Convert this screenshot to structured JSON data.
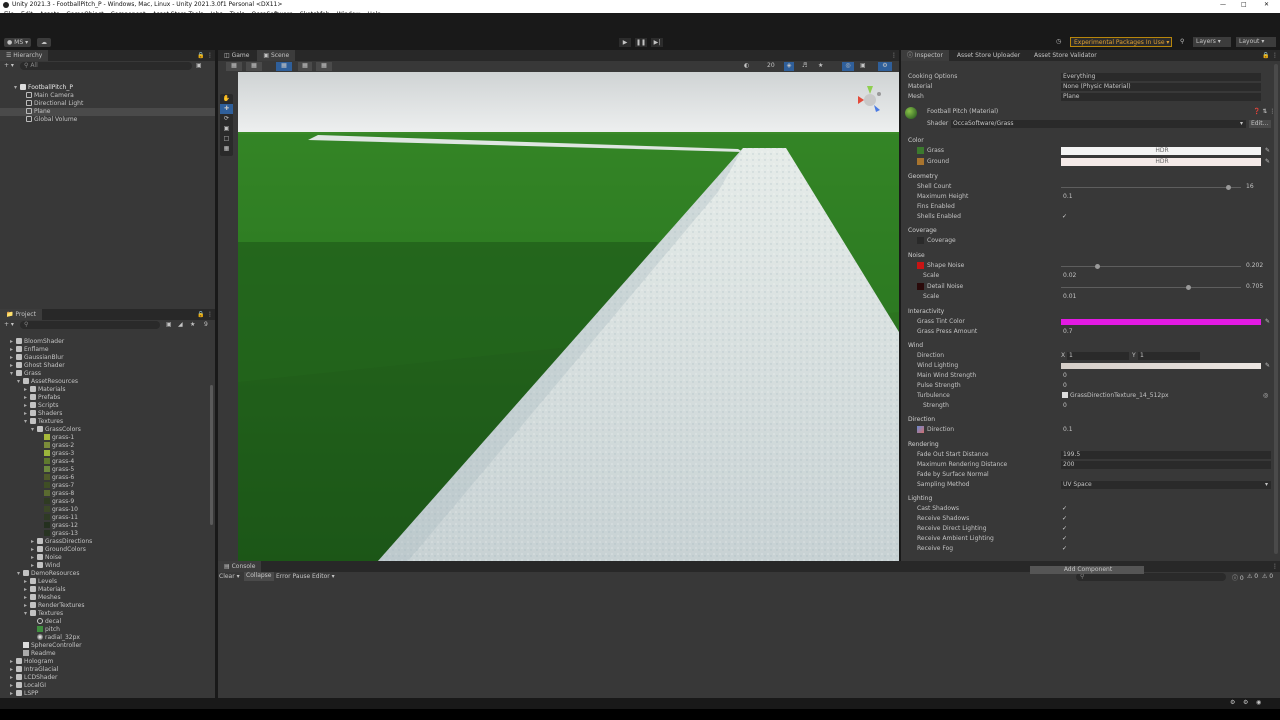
{
  "window": {
    "title": "Unity 2021.3 - FootballPitch_P - Windows, Mac, Linux - Unity 2021.3.0f1 Personal <DX11>"
  },
  "menu": [
    "File",
    "Edit",
    "Assets",
    "GameObject",
    "Component",
    "Asset Store Tools",
    "Jobs",
    "Tools",
    "OccaSoftware",
    "Sketchfab",
    "Window",
    "Help"
  ],
  "toolbar": {
    "account": "MS",
    "experimental": "Experimental Packages In Use",
    "layers": "Layers",
    "layout": "Layout"
  },
  "hierarchy": {
    "tab": "Hierarchy",
    "search": "All",
    "scene": "FootballPitch_P",
    "items": [
      "Main Camera",
      "Directional Light",
      "Plane",
      "Global Volume"
    ]
  },
  "project": {
    "tab": "Project",
    "count": "9",
    "tree": [
      {
        "label": "BloomShader",
        "indent": 1,
        "kind": "folder"
      },
      {
        "label": "Enflame",
        "indent": 1,
        "kind": "folder"
      },
      {
        "label": "GaussianBlur",
        "indent": 1,
        "kind": "folder"
      },
      {
        "label": "Ghost Shader",
        "indent": 1,
        "kind": "folder"
      },
      {
        "label": "Grass",
        "indent": 1,
        "kind": "folder",
        "open": true
      },
      {
        "label": "AssetResources",
        "indent": 2,
        "kind": "folder",
        "open": true
      },
      {
        "label": "Materials",
        "indent": 3,
        "kind": "folder"
      },
      {
        "label": "Prefabs",
        "indent": 3,
        "kind": "folder"
      },
      {
        "label": "Scripts",
        "indent": 3,
        "kind": "folder"
      },
      {
        "label": "Shaders",
        "indent": 3,
        "kind": "folder"
      },
      {
        "label": "Textures",
        "indent": 3,
        "kind": "folder",
        "open": true
      },
      {
        "label": "GrassColors",
        "indent": 4,
        "kind": "folder",
        "open": true
      },
      {
        "label": "grass-1",
        "indent": 5,
        "kind": "tex",
        "color": "#a6b83a"
      },
      {
        "label": "grass-2",
        "indent": 5,
        "kind": "tex",
        "color": "#7b8c3a"
      },
      {
        "label": "grass-3",
        "indent": 5,
        "kind": "tex",
        "color": "#9bb63c"
      },
      {
        "label": "grass-4",
        "indent": 5,
        "kind": "tex",
        "color": "#5f7a2e"
      },
      {
        "label": "grass-5",
        "indent": 5,
        "kind": "tex",
        "color": "#6d8a3e"
      },
      {
        "label": "grass-6",
        "indent": 5,
        "kind": "tex",
        "color": "#4f5a2a"
      },
      {
        "label": "grass-7",
        "indent": 5,
        "kind": "tex",
        "color": "#3f4e25"
      },
      {
        "label": "grass-8",
        "indent": 5,
        "kind": "tex",
        "color": "#5a6a30"
      },
      {
        "label": "grass-9",
        "indent": 5,
        "kind": "tex",
        "color": "#2f3b22"
      },
      {
        "label": "grass-10",
        "indent": 5,
        "kind": "tex",
        "color": "#3b4727"
      },
      {
        "label": "grass-11",
        "indent": 5,
        "kind": "tex",
        "color": "#2e3a24"
      },
      {
        "label": "grass-12",
        "indent": 5,
        "kind": "tex",
        "color": "#24301f"
      },
      {
        "label": "grass-13",
        "indent": 5,
        "kind": "tex",
        "color": "#283422"
      },
      {
        "label": "GrassDirections",
        "indent": 4,
        "kind": "folder"
      },
      {
        "label": "GroundColors",
        "indent": 4,
        "kind": "folder"
      },
      {
        "label": "Noise",
        "indent": 4,
        "kind": "folder"
      },
      {
        "label": "Wind",
        "indent": 4,
        "kind": "folder"
      },
      {
        "label": "DemoResources",
        "indent": 2,
        "kind": "folder",
        "open": true
      },
      {
        "label": "Levels",
        "indent": 3,
        "kind": "folder"
      },
      {
        "label": "Materials",
        "indent": 3,
        "kind": "folder"
      },
      {
        "label": "Meshes",
        "indent": 3,
        "kind": "folder"
      },
      {
        "label": "RenderTextures",
        "indent": 3,
        "kind": "folder"
      },
      {
        "label": "Textures",
        "indent": 3,
        "kind": "folder",
        "open": true
      },
      {
        "label": "decal",
        "indent": 4,
        "kind": "circle"
      },
      {
        "label": "pitch",
        "indent": 4,
        "kind": "tex",
        "color": "#3f8f3f"
      },
      {
        "label": "radial_32px",
        "indent": 4,
        "kind": "dot"
      },
      {
        "label": "SphereController",
        "indent": 2,
        "kind": "script"
      },
      {
        "label": "Readme",
        "indent": 2,
        "kind": "doc"
      },
      {
        "label": "Hologram",
        "indent": 1,
        "kind": "folder"
      },
      {
        "label": "IntraGlacial",
        "indent": 1,
        "kind": "folder"
      },
      {
        "label": "LCDShader",
        "indent": 1,
        "kind": "folder"
      },
      {
        "label": "LocalGI",
        "indent": 1,
        "kind": "folder"
      },
      {
        "label": "LSPP",
        "indent": 1,
        "kind": "folder"
      }
    ]
  },
  "view": {
    "tabs": [
      "Game",
      "Scene"
    ],
    "active_tab": "Scene",
    "zoom": "20",
    "mode": "2D"
  },
  "console": {
    "tab": "Console",
    "buttons": [
      "Clear",
      "Collapse",
      "Error Pause",
      "Editor"
    ],
    "counts": [
      "0",
      "0",
      "0"
    ]
  },
  "inspector": {
    "tabs": [
      "Inspector",
      "Asset Store Uploader",
      "Asset Store Validator"
    ],
    "top_rows": [
      {
        "label": "Cooking Options",
        "value": "Everything"
      },
      {
        "label": "Material",
        "value": "None (Physic Material)"
      },
      {
        "label": "Mesh",
        "value": "Plane"
      }
    ],
    "material": {
      "name": "Football Pitch (Material)",
      "shader_label": "Shader",
      "shader": "OccaSoftware/Grass",
      "edit": "Edit..."
    },
    "sections": {
      "color": "Color",
      "geometry": "Geometry",
      "coverage": "Coverage",
      "noise": "Noise",
      "interactivity": "Interactivity",
      "wind": "Wind",
      "direction": "Direction",
      "rendering": "Rendering",
      "lighting": "Lighting"
    },
    "color": {
      "grass": "Grass",
      "grass_swatch": "#3c7a2e",
      "ground": "Ground",
      "ground_swatch": "#a8742e",
      "hdr": "HDR"
    },
    "geometry": {
      "shell_count": "Shell Count",
      "shell_count_val": "16",
      "shell_count_frac": 0.93,
      "max_height": "Maximum Height",
      "max_height_val": "0.1",
      "fins": "Fins Enabled",
      "fins_checked": false,
      "shells": "Shells Enabled",
      "shells_checked": true
    },
    "coverage": {
      "label": "Coverage"
    },
    "noise": {
      "shape": "Shape Noise",
      "shape_val": "0.202",
      "shape_frac": 0.202,
      "shape_color": "#c81414",
      "scale1": "Scale",
      "scale1_val": "0.02",
      "detail": "Detail Noise",
      "detail_val": "0.705",
      "detail_frac": 0.705,
      "detail_color": "#2a0a0a",
      "scale2": "Scale",
      "scale2_val": "0.01"
    },
    "interactivity": {
      "tint": "Grass Tint Color",
      "tint_color": "#e31ae3",
      "press": "Grass Press Amount",
      "press_val": "0.7"
    },
    "wind": {
      "direction": "Direction",
      "dir_x_label": "X",
      "dir_x": "1",
      "dir_y_label": "Y",
      "dir_y": "1",
      "lighting": "Wind Lighting",
      "main": "Main Wind Strength",
      "main_val": "0",
      "pulse": "Pulse Strength",
      "pulse_val": "0",
      "turbulence": "Turbulence",
      "turbulence_val": "GrassDirectionTexture_14_512px",
      "strength": "Strength",
      "strength_val": "0"
    },
    "direction": {
      "label": "Direction",
      "value": "0.1"
    },
    "rendering": {
      "fade_start": "Fade Out Start Distance",
      "fade_start_val": "199.5",
      "max_dist": "Maximum Rendering Distance",
      "max_dist_val": "200",
      "fade_normal": "Fade by Surface Normal",
      "sampling": "Sampling Method",
      "sampling_val": "UV Space"
    },
    "lighting": {
      "cast": "Cast Shadows",
      "receive": "Receive Shadows",
      "direct": "Receive Direct Lighting",
      "ambient": "Receive Ambient Lighting",
      "fog": "Receive Fog"
    },
    "add_component": "Add Component"
  }
}
